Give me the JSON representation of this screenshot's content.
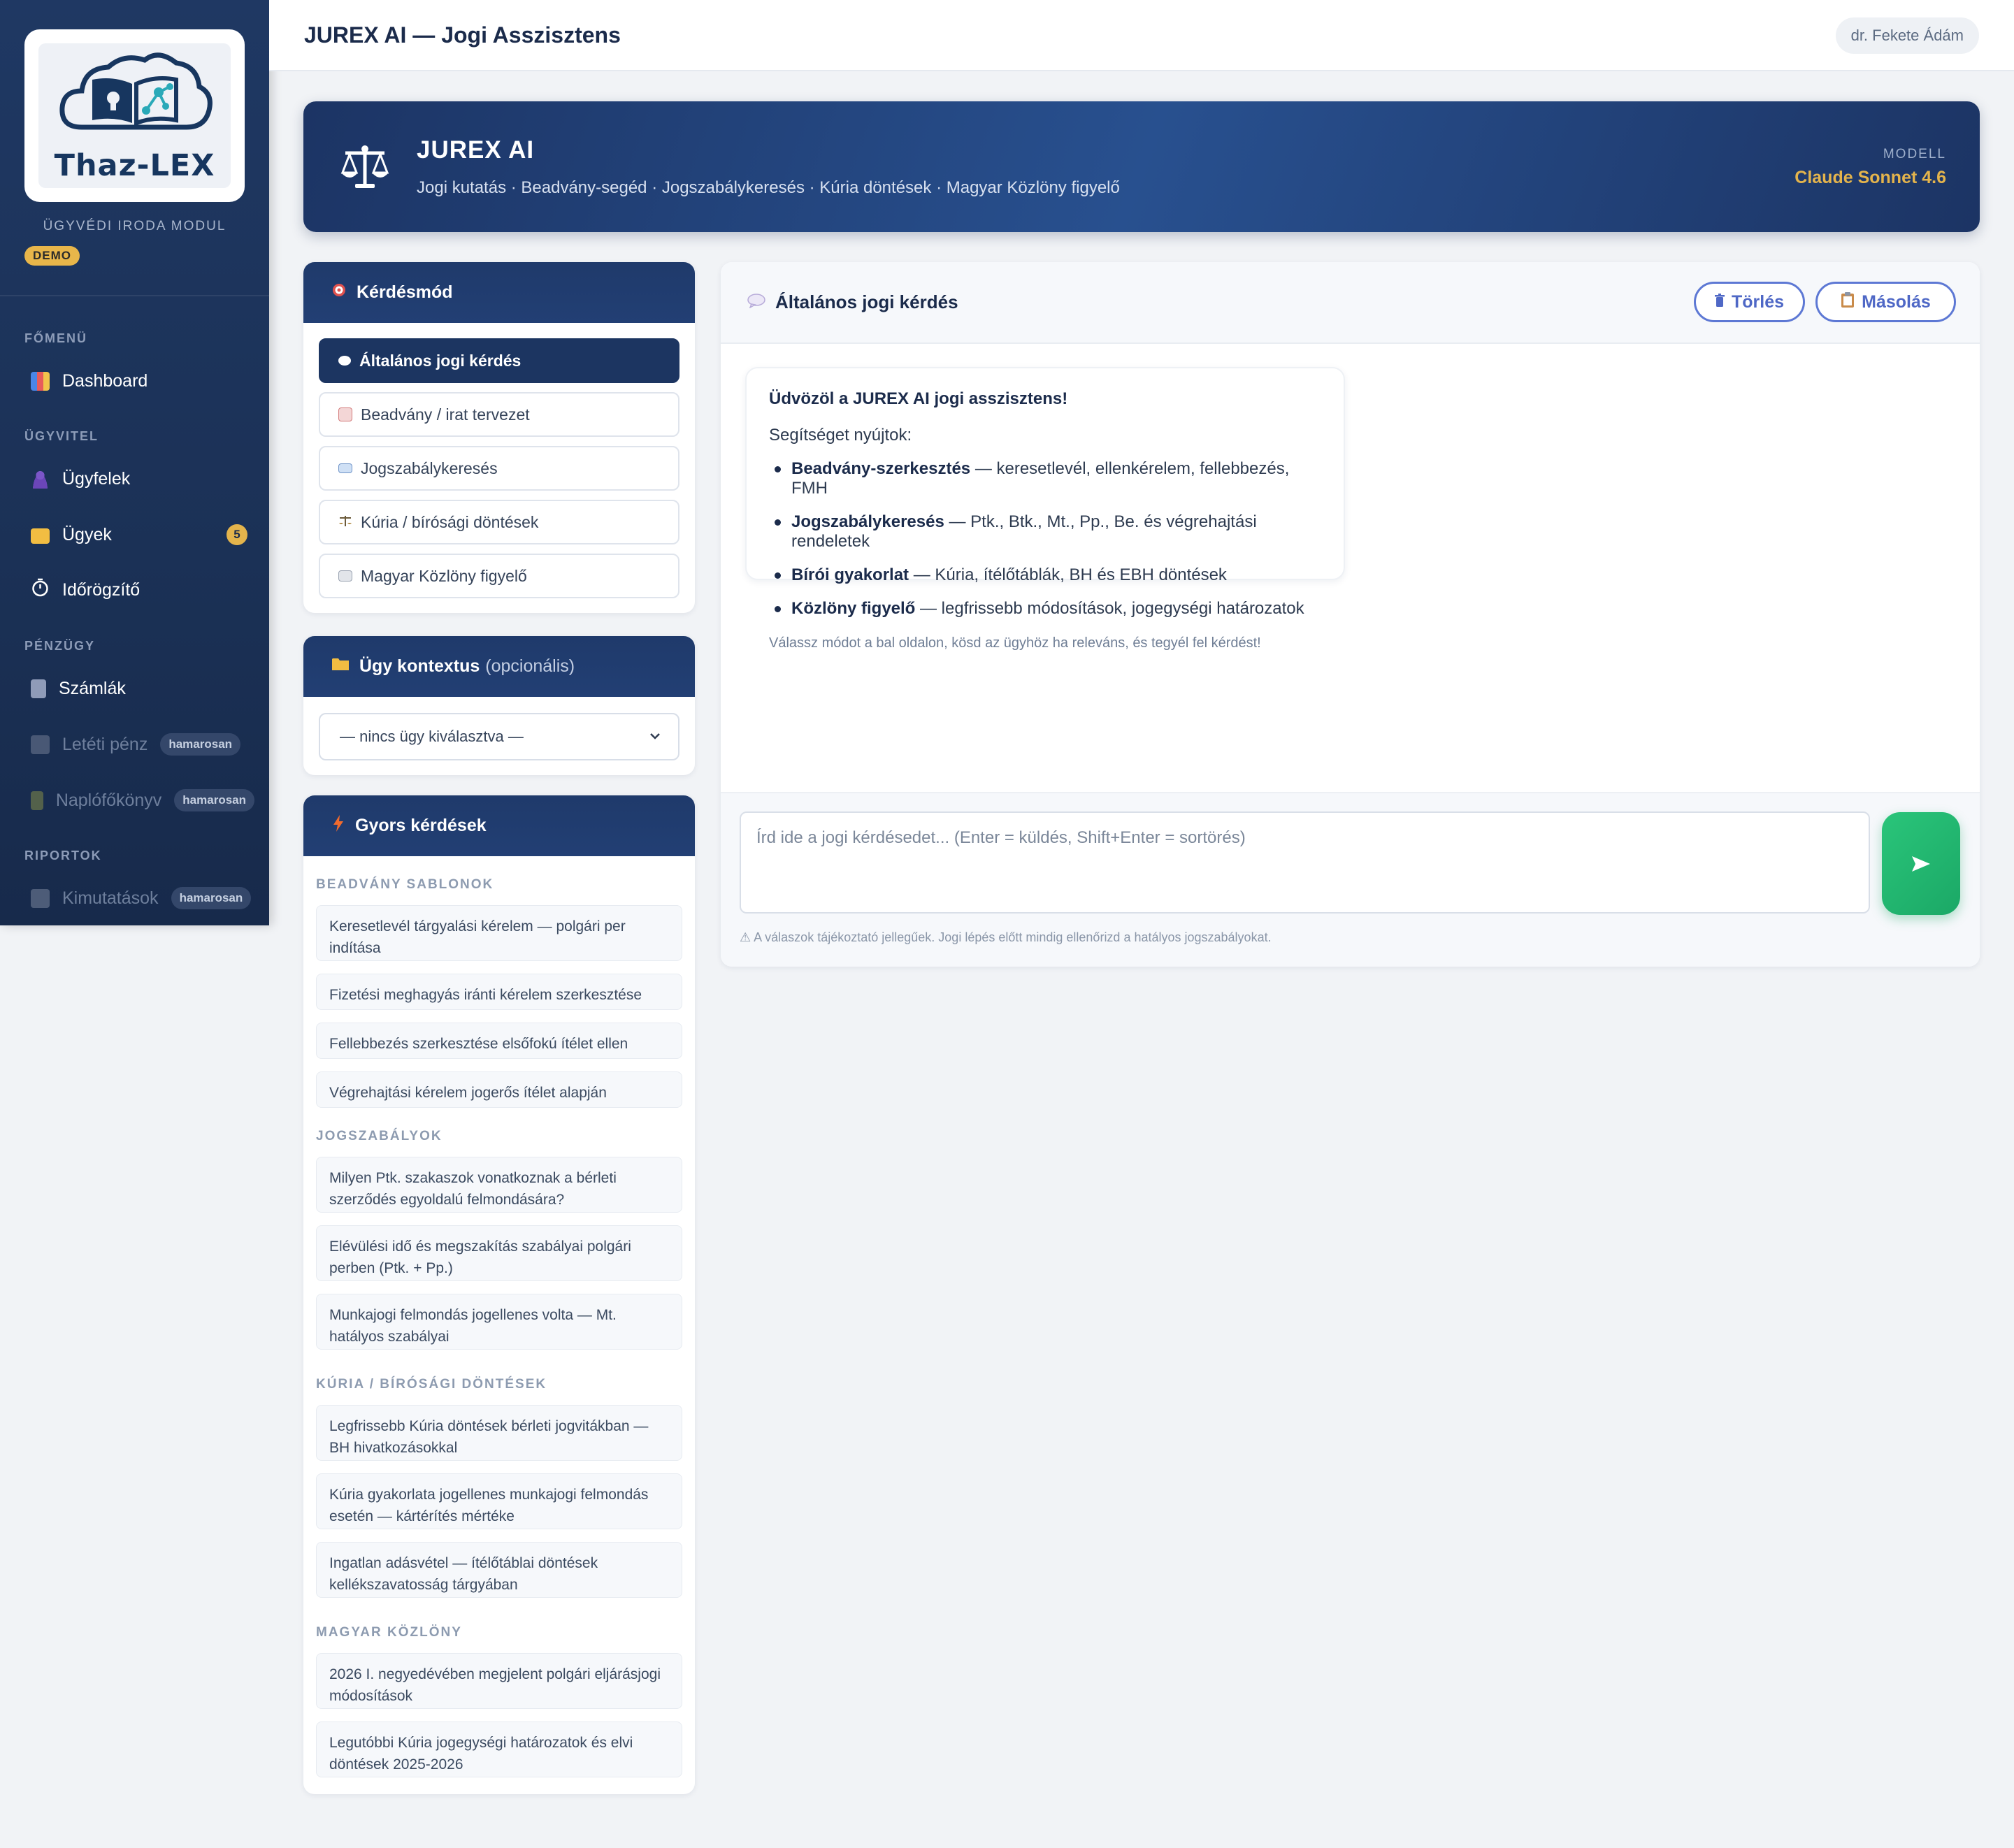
{
  "sidebar": {
    "logo_text": "Thaz-LEX",
    "module_label": "ÜGYVÉDI IRODA MODUL",
    "demo_badge": "DEMO",
    "sections": {
      "main": "FŐMENÜ",
      "operations": "ÜGYVITEL",
      "finance": "PÉNZÜGY",
      "reports": "RIPORTOK"
    },
    "items": [
      {
        "label": "Dashboard",
        "icon": "chart-icon"
      },
      {
        "label": "Ügyfelek",
        "icon": "person-icon"
      },
      {
        "label": "Ügyek",
        "icon": "folder-icon",
        "badge": "5"
      },
      {
        "label": "Időrögzítő",
        "icon": "stopwatch-icon"
      },
      {
        "label": "Számlák",
        "icon": "invoice-icon"
      },
      {
        "label": "Letéti pénz",
        "icon": "bank-icon",
        "badge": "hamarosan"
      },
      {
        "label": "Naplófőkönyv",
        "icon": "ledger-icon",
        "badge": "hamarosan"
      },
      {
        "label": "Kimutatások",
        "icon": "trend-chart-icon",
        "badge": "hamarosan"
      }
    ]
  },
  "topbar": {
    "title": "JUREX AI — Jogi Asszisztens",
    "user": "dr. Fekete Ádám"
  },
  "hero": {
    "title": "JUREX AI",
    "subtitle": "Jogi kutatás · Beadvány-segéd · Jogszabálykeresés · Kúria döntések · Magyar Közlöny figyelő",
    "model_label": "MODELL",
    "model_name": "Claude Sonnet 4.6"
  },
  "mode_panel": {
    "title": "Kérdésmód",
    "modes": [
      {
        "label": "Általános jogi kérdés",
        "active": true
      },
      {
        "label": "Beadvány / irat tervezet",
        "active": false
      },
      {
        "label": "Jogszabálykeresés",
        "active": false
      },
      {
        "label": "Kúria / bírósági döntések",
        "active": false
      },
      {
        "label": "Magyar Közlöny figyelő",
        "active": false
      }
    ]
  },
  "context_panel": {
    "title": "Ügy kontextus",
    "title_suffix": "(opcionális)",
    "selected": "— nincs ügy kiválasztva —"
  },
  "quick_panel": {
    "title": "Gyors kérdések",
    "groups": [
      {
        "heading": "BEADVÁNY SABLONOK",
        "items": [
          "Keresetlevél tárgyalási kérelem — polgári per indítása",
          "Fizetési meghagyás iránti kérelem szerkesztése",
          "Fellebbezés szerkesztése elsőfokú ítélet ellen",
          "Végrehajtási kérelem jogerős ítélet alapján"
        ]
      },
      {
        "heading": "JOGSZABÁLYOK",
        "items": [
          "Milyen Ptk. szakaszok vonatkoznak a bérleti szerződés egyoldalú felmondására?",
          "Elévülési idő és megszakítás szabályai polgári perben (Ptk. + Pp.)",
          "Munkajogi felmondás jogellenes volta — Mt. hatályos szabályai"
        ]
      },
      {
        "heading": "KÚRIA / BÍRÓSÁGI DÖNTÉSEK",
        "items": [
          "Legfrissebb Kúria döntések bérleti jogvitákban — BH hivatkozásokkal",
          "Kúria gyakorlata jogellenes munkajogi felmondás esetén — kártérítés mértéke",
          "Ingatlan adásvétel — ítélőtáblai döntések kellékszavatosság tárgyában"
        ]
      },
      {
        "heading": "MAGYAR KÖZLÖNY",
        "items": [
          "2026 I. negyedévében megjelent polgári eljárásjogi módosítások",
          "Legutóbbi Kúria jogegységi határozatok és elvi döntések 2025-2026"
        ]
      }
    ]
  },
  "chat": {
    "title": "Általános jogi kérdés",
    "clear_label": "Törlés",
    "copy_label": "Másolás",
    "welcome": {
      "title": "Üdvözöl a JUREX AI jogi asszisztens!",
      "intro": "Segítséget nyújtok:",
      "features": [
        {
          "bold": "Beadvány-szerkesztés",
          "text": " — keresetlevél, ellenkérelem, fellebbezés, FMH"
        },
        {
          "bold": "Jogszabálykeresés",
          "text": " — Ptk., Btk., Mt., Pp., Be. és végrehajtási rendeletek"
        },
        {
          "bold": "Bírói gyakorlat",
          "text": " — Kúria, ítélőtáblák, BH és EBH döntések"
        },
        {
          "bold": "Közlöny figyelő",
          "text": " — legfrissebb módosítások, jogegységi határozatok"
        }
      ],
      "hint": "Válassz módot a bal oldalon, kösd az ügyhöz ha releváns, és tegyél fel kérdést!"
    },
    "input_placeholder": "Írd ide a jogi kérdésedet... (Enter = küldés, Shift+Enter = sortörés)",
    "input_value": "",
    "disclaimer": "⚠ A válaszok tájékoztató jellegűek. Jogi lépés előtt mindig ellenőrizd a hatályos jogszabályokat."
  },
  "colors": {
    "sidebar_bg": "#1f3863",
    "accent_gold": "#e4b44c",
    "hero_blue": "#28508f",
    "send_green": "#1ba866",
    "button_blue": "#5d78d4"
  }
}
